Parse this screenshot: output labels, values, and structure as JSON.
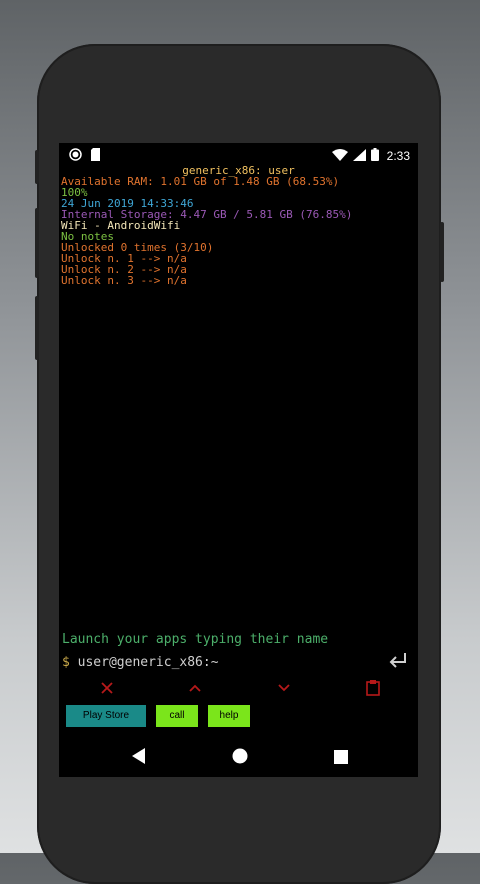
{
  "status_bar": {
    "time": "2:33",
    "left_icons": [
      "record-icon",
      "sd-card-icon"
    ],
    "right_icons": [
      "wifi-icon",
      "signal-icon",
      "battery-icon"
    ]
  },
  "terminal": {
    "header": "generic_x86: user",
    "lines": [
      {
        "text": "Available RAM: 1.01 GB of 1.48 GB (68.53%)",
        "color": "#e0732e"
      },
      {
        "text": "100%",
        "color": "#7cc142"
      },
      {
        "text": "24 Jun 2019 14:33:46",
        "color": "#3fa7d6"
      },
      {
        "text": "Internal Storage: 4.47 GB / 5.81 GB (76.85%)",
        "color": "#9b59b6"
      },
      {
        "text": "WiFi - AndroidWifi",
        "color": "#f3e6b8"
      },
      {
        "text": "No notes",
        "color": "#7cc142"
      },
      {
        "text": "Unlocked 0 times (3/10)",
        "color": "#e0732e"
      },
      {
        "text": "Unlock n. 1 --> n/a",
        "color": "#e0732e"
      },
      {
        "text": "Unlock n. 2 --> n/a",
        "color": "#e0732e"
      },
      {
        "text": "Unlock n. 3 --> n/a",
        "color": "#e0732e"
      }
    ],
    "header_color": "#f0c060"
  },
  "hint": "Launch your apps typing their name",
  "prompt": {
    "symbol": "$",
    "text": "user@generic_x86:~"
  },
  "toolbar": {
    "icons": [
      "close-icon",
      "arrow-up-icon",
      "arrow-down-icon",
      "clipboard-icon"
    ],
    "color": "#b7191a"
  },
  "shortcuts": [
    {
      "label": "Play Store",
      "bg": "#1a8a88",
      "fg": "#000000"
    },
    {
      "label": "call",
      "bg": "#7be51b",
      "fg": "#000000"
    },
    {
      "label": "help",
      "bg": "#7be51b",
      "fg": "#000000"
    }
  ],
  "navigation": [
    "back-icon",
    "home-icon",
    "recents-icon"
  ]
}
